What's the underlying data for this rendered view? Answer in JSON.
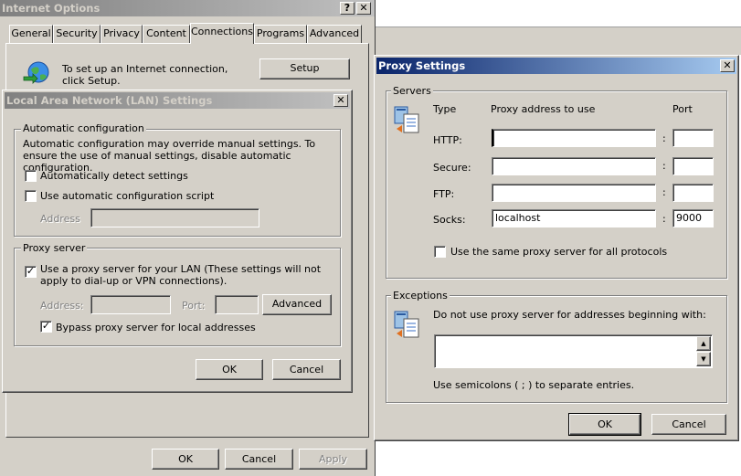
{
  "internet_options": {
    "title": "Internet Options",
    "help_glyph": "?",
    "close_glyph": "✕",
    "tabs": [
      "General",
      "Security",
      "Privacy",
      "Content",
      "Connections",
      "Programs",
      "Advanced"
    ],
    "selected_tab": "Connections",
    "setup_text": "To set up an Internet connection, click Setup.",
    "setup_button": "Setup",
    "ok": "OK",
    "cancel": "Cancel",
    "apply": "Apply"
  },
  "lan_settings": {
    "title": "Local Area Network (LAN) Settings",
    "close_glyph": "✕",
    "auto_config_group": "Automatic configuration",
    "auto_config_desc": "Automatic configuration may override manual settings.  To ensure the use of manual settings, disable automatic configuration.",
    "auto_detect_label": "Automatically detect settings",
    "auto_detect_checked": false,
    "auto_script_label": "Use automatic configuration script",
    "auto_script_checked": false,
    "address_label": "Address",
    "address_value": "",
    "proxy_group": "Proxy server",
    "use_proxy_label": "Use a proxy server for your LAN (These settings will not apply to dial-up or VPN connections).",
    "use_proxy_checked": true,
    "proxy_address_label": "Address:",
    "proxy_address_value": "",
    "port_label": "Port:",
    "port_value": "",
    "advanced_button": "Advanced",
    "bypass_label": "Bypass proxy server for local addresses",
    "bypass_checked": true,
    "ok": "OK",
    "cancel": "Cancel"
  },
  "proxy_settings": {
    "title": "Proxy Settings",
    "close_glyph": "✕",
    "servers_group": "Servers",
    "col_type": "Type",
    "col_address": "Proxy address to use",
    "col_port": "Port",
    "rows": [
      {
        "type": "HTTP:",
        "address": "",
        "port": ""
      },
      {
        "type": "Secure:",
        "address": "",
        "port": ""
      },
      {
        "type": "FTP:",
        "address": "",
        "port": ""
      },
      {
        "type": "Socks:",
        "address": "localhost",
        "port": "9000"
      }
    ],
    "colon": ":",
    "same_proxy_label": "Use the same proxy server for all protocols",
    "same_proxy_checked": false,
    "exceptions_group": "Exceptions",
    "exceptions_desc": "Do not use proxy server for addresses beginning with:",
    "exceptions_value": "",
    "exceptions_hint": "Use semicolons ( ; ) to separate entries.",
    "ok": "OK",
    "cancel": "Cancel"
  }
}
